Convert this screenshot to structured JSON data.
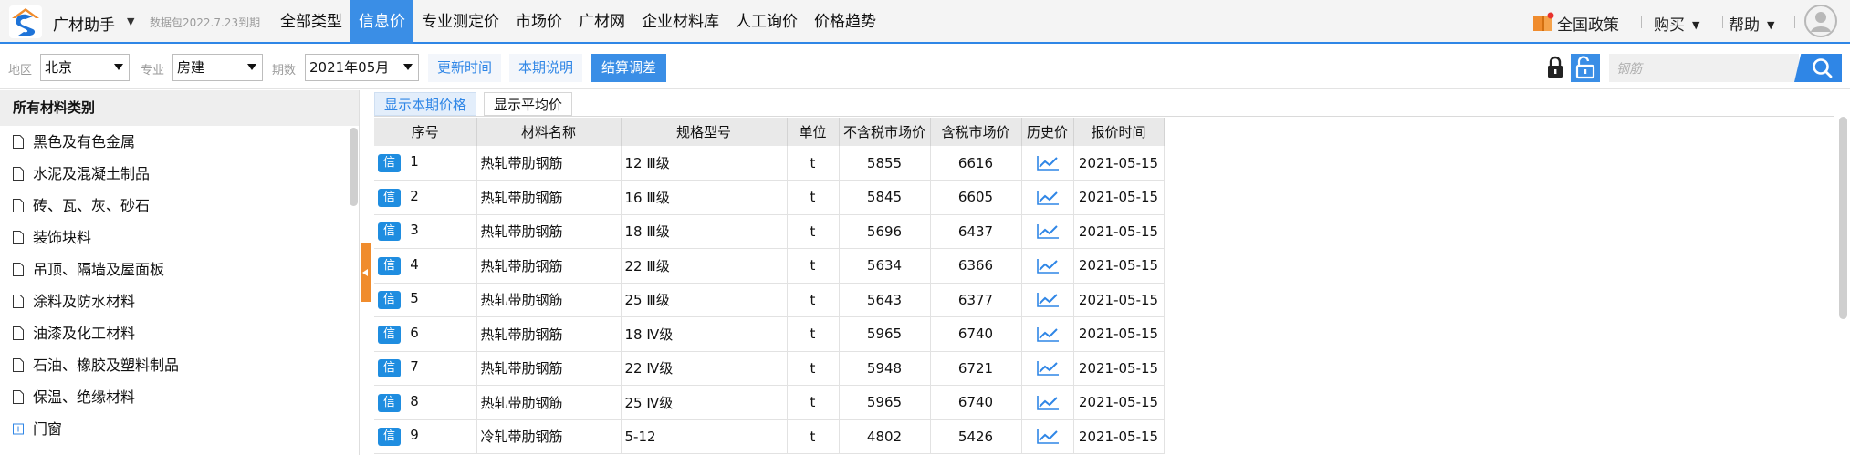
{
  "app": {
    "name": "广材助手",
    "version_note": "数据包2022.7.23到期"
  },
  "nav": {
    "items": [
      "全部类型",
      "信息价",
      "专业测定价",
      "市场价",
      "广材网",
      "企业材料库",
      "人工询价",
      "价格趋势"
    ],
    "active": "信息价"
  },
  "top_right": {
    "policy": "全国政策",
    "buy": "购买",
    "help": "帮助"
  },
  "filters": {
    "region_label": "地区",
    "region_value": "北京",
    "major_label": "专业",
    "major_value": "房建",
    "period_label": "期数",
    "period_value": "2021年05月",
    "update_time_button": "更新时间",
    "period_note_button": "本期说明",
    "settle_button": "结算调差",
    "search_placeholder": "钢筋"
  },
  "sidebar": {
    "title": "所有材料类别",
    "items": [
      {
        "label": "黑色及有色金属",
        "type": "doc"
      },
      {
        "label": "水泥及混凝土制品",
        "type": "doc"
      },
      {
        "label": "砖、瓦、灰、砂石",
        "type": "doc"
      },
      {
        "label": "装饰块料",
        "type": "doc"
      },
      {
        "label": "吊顶、隔墙及屋面板",
        "type": "doc"
      },
      {
        "label": "涂料及防水材料",
        "type": "doc"
      },
      {
        "label": "油漆及化工材料",
        "type": "doc"
      },
      {
        "label": "石油、橡胶及塑料制品",
        "type": "doc"
      },
      {
        "label": "保温、绝缘材料",
        "type": "doc"
      },
      {
        "label": "门窗",
        "type": "expand"
      }
    ]
  },
  "tabs": {
    "current": "显示本期价格",
    "average": "显示平均价"
  },
  "table": {
    "headers": [
      "序号",
      "材料名称",
      "规格型号",
      "单位",
      "不含税市场价",
      "含税市场价",
      "历史价",
      "报价时间"
    ],
    "badge": "信",
    "rows": [
      {
        "seq": "1",
        "name": "热轧带肋钢筋",
        "spec": "12 Ⅲ级",
        "unit": "t",
        "price_ex": "5855",
        "price_in": "6616",
        "date": "2021-05-15"
      },
      {
        "seq": "2",
        "name": "热轧带肋钢筋",
        "spec": "16 Ⅲ级",
        "unit": "t",
        "price_ex": "5845",
        "price_in": "6605",
        "date": "2021-05-15"
      },
      {
        "seq": "3",
        "name": "热轧带肋钢筋",
        "spec": "18 Ⅲ级",
        "unit": "t",
        "price_ex": "5696",
        "price_in": "6437",
        "date": "2021-05-15"
      },
      {
        "seq": "4",
        "name": "热轧带肋钢筋",
        "spec": "22 Ⅲ级",
        "unit": "t",
        "price_ex": "5634",
        "price_in": "6366",
        "date": "2021-05-15"
      },
      {
        "seq": "5",
        "name": "热轧带肋钢筋",
        "spec": "25 Ⅲ级",
        "unit": "t",
        "price_ex": "5643",
        "price_in": "6377",
        "date": "2021-05-15"
      },
      {
        "seq": "6",
        "name": "热轧带肋钢筋",
        "spec": "18 Ⅳ级",
        "unit": "t",
        "price_ex": "5965",
        "price_in": "6740",
        "date": "2021-05-15"
      },
      {
        "seq": "7",
        "name": "热轧带肋钢筋",
        "spec": "22 Ⅳ级",
        "unit": "t",
        "price_ex": "5948",
        "price_in": "6721",
        "date": "2021-05-15"
      },
      {
        "seq": "8",
        "name": "热轧带肋钢筋",
        "spec": "25 Ⅳ级",
        "unit": "t",
        "price_ex": "5965",
        "price_in": "6740",
        "date": "2021-05-15"
      },
      {
        "seq": "9",
        "name": "冷轧带肋钢筋",
        "spec": "5-12",
        "unit": "t",
        "price_ex": "4802",
        "price_in": "5426",
        "date": "2021-05-15"
      }
    ]
  },
  "colors": {
    "accent": "#2f86e6",
    "active_nav": "#3a8ee6",
    "badge": "#1f8de0",
    "collapse_tab": "#f08c2d"
  }
}
